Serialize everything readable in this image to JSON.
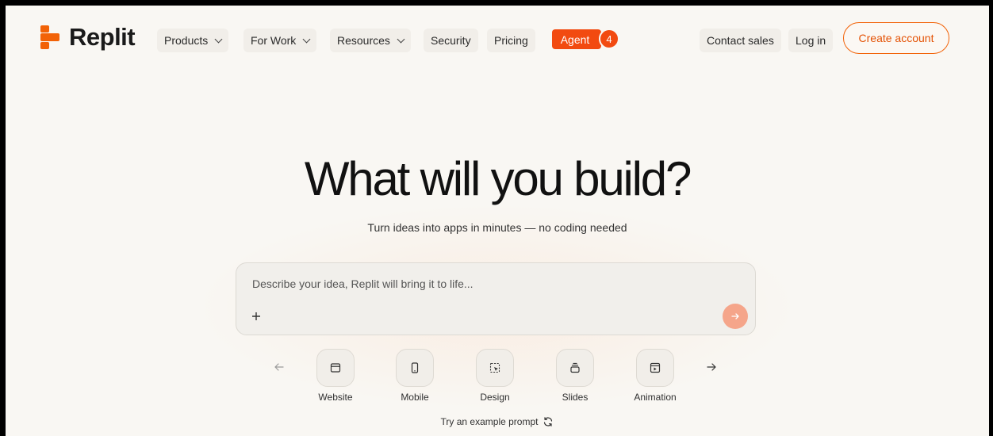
{
  "header": {
    "brand": "Replit",
    "nav": [
      {
        "label": "Products",
        "dropdown": true
      },
      {
        "label": "For Work",
        "dropdown": true
      },
      {
        "label": "Resources",
        "dropdown": true
      },
      {
        "label": "Security",
        "dropdown": false
      },
      {
        "label": "Pricing",
        "dropdown": false
      }
    ],
    "agent_label": "Agent",
    "agent_badge": "4",
    "contact_label": "Contact sales",
    "login_label": "Log in",
    "create_account_label": "Create account"
  },
  "hero": {
    "title": "What will you build?",
    "subtitle": "Turn ideas into apps in minutes — no coding needed"
  },
  "prompt": {
    "placeholder": "Describe your idea, Replit will bring it to life...",
    "value": "",
    "add_icon": "plus-icon",
    "send_icon": "arrow-right-icon"
  },
  "categories": [
    {
      "label": "Website",
      "icon": "browser-window-icon"
    },
    {
      "label": "Mobile",
      "icon": "phone-icon"
    },
    {
      "label": "Design",
      "icon": "design-select-icon"
    },
    {
      "label": "Slides",
      "icon": "slides-icon"
    },
    {
      "label": "Animation",
      "icon": "animation-play-icon"
    }
  ],
  "example_prompt": {
    "label": "Try an example prompt",
    "icon": "refresh-icon"
  },
  "colors": {
    "brand": "#f26207",
    "agent": "#f24a10",
    "background": "#f9f7f3",
    "send_button": "#f5a58a"
  }
}
